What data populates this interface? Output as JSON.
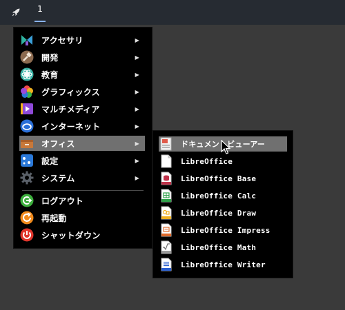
{
  "taskbar": {
    "workspace_label": "1",
    "launcher_icon": "rocket-icon"
  },
  "main_menu": {
    "items": [
      {
        "label": "アクセサリ",
        "icon": "accessories-icon",
        "color": "#3aa0d8",
        "submenu": true
      },
      {
        "label": "開発",
        "icon": "development-icon",
        "color": "#8b6a4f",
        "submenu": true
      },
      {
        "label": "教育",
        "icon": "education-icon",
        "color": "#3bb3a6",
        "submenu": true
      },
      {
        "label": "グラフィックス",
        "icon": "graphics-icon",
        "color": "#e8662c",
        "submenu": true
      },
      {
        "label": "マルチメディア",
        "icon": "multimedia-icon",
        "color": "#8f4ad8",
        "submenu": true
      },
      {
        "label": "インターネット",
        "icon": "internet-icon",
        "color": "#2a6fd8",
        "submenu": true
      },
      {
        "label": "オフィス",
        "icon": "office-icon",
        "color": "#c8783a",
        "submenu": true,
        "active": true
      },
      {
        "label": "設定",
        "icon": "settings-icon",
        "color": "#2a78d8",
        "submenu": true
      },
      {
        "label": "システム",
        "icon": "system-icon",
        "color": "#5a6068",
        "submenu": true
      },
      {
        "label": "ログアウト",
        "icon": "logout-icon",
        "color": "#3cae3c",
        "submenu": false
      },
      {
        "label": "再起動",
        "icon": "restart-icon",
        "color": "#f08a1c",
        "submenu": false
      },
      {
        "label": "シャットダウン",
        "icon": "shutdown-icon",
        "color": "#e0342b",
        "submenu": false
      }
    ]
  },
  "office_submenu": {
    "items": [
      {
        "label": "ドキュメントビューアー",
        "icon": "document-viewer-icon",
        "color": "#e05a4a",
        "active": true
      },
      {
        "label": "LibreOffice",
        "icon": "libreoffice-icon",
        "color": "#ffffff"
      },
      {
        "label": "LibreOffice Base",
        "icon": "libreoffice-base-icon",
        "color": "#c0324a"
      },
      {
        "label": "LibreOffice Calc",
        "icon": "libreoffice-calc-icon",
        "color": "#2fa24a"
      },
      {
        "label": "LibreOffice Draw",
        "icon": "libreoffice-draw-icon",
        "color": "#f0b020"
      },
      {
        "label": "LibreOffice Impress",
        "icon": "libreoffice-impress-icon",
        "color": "#e06a2a"
      },
      {
        "label": "LibreOffice Math",
        "icon": "libreoffice-math-icon",
        "color": "#9a9a9a"
      },
      {
        "label": "LibreOffice Writer",
        "icon": "libreoffice-writer-icon",
        "color": "#2a5fd0"
      }
    ]
  }
}
